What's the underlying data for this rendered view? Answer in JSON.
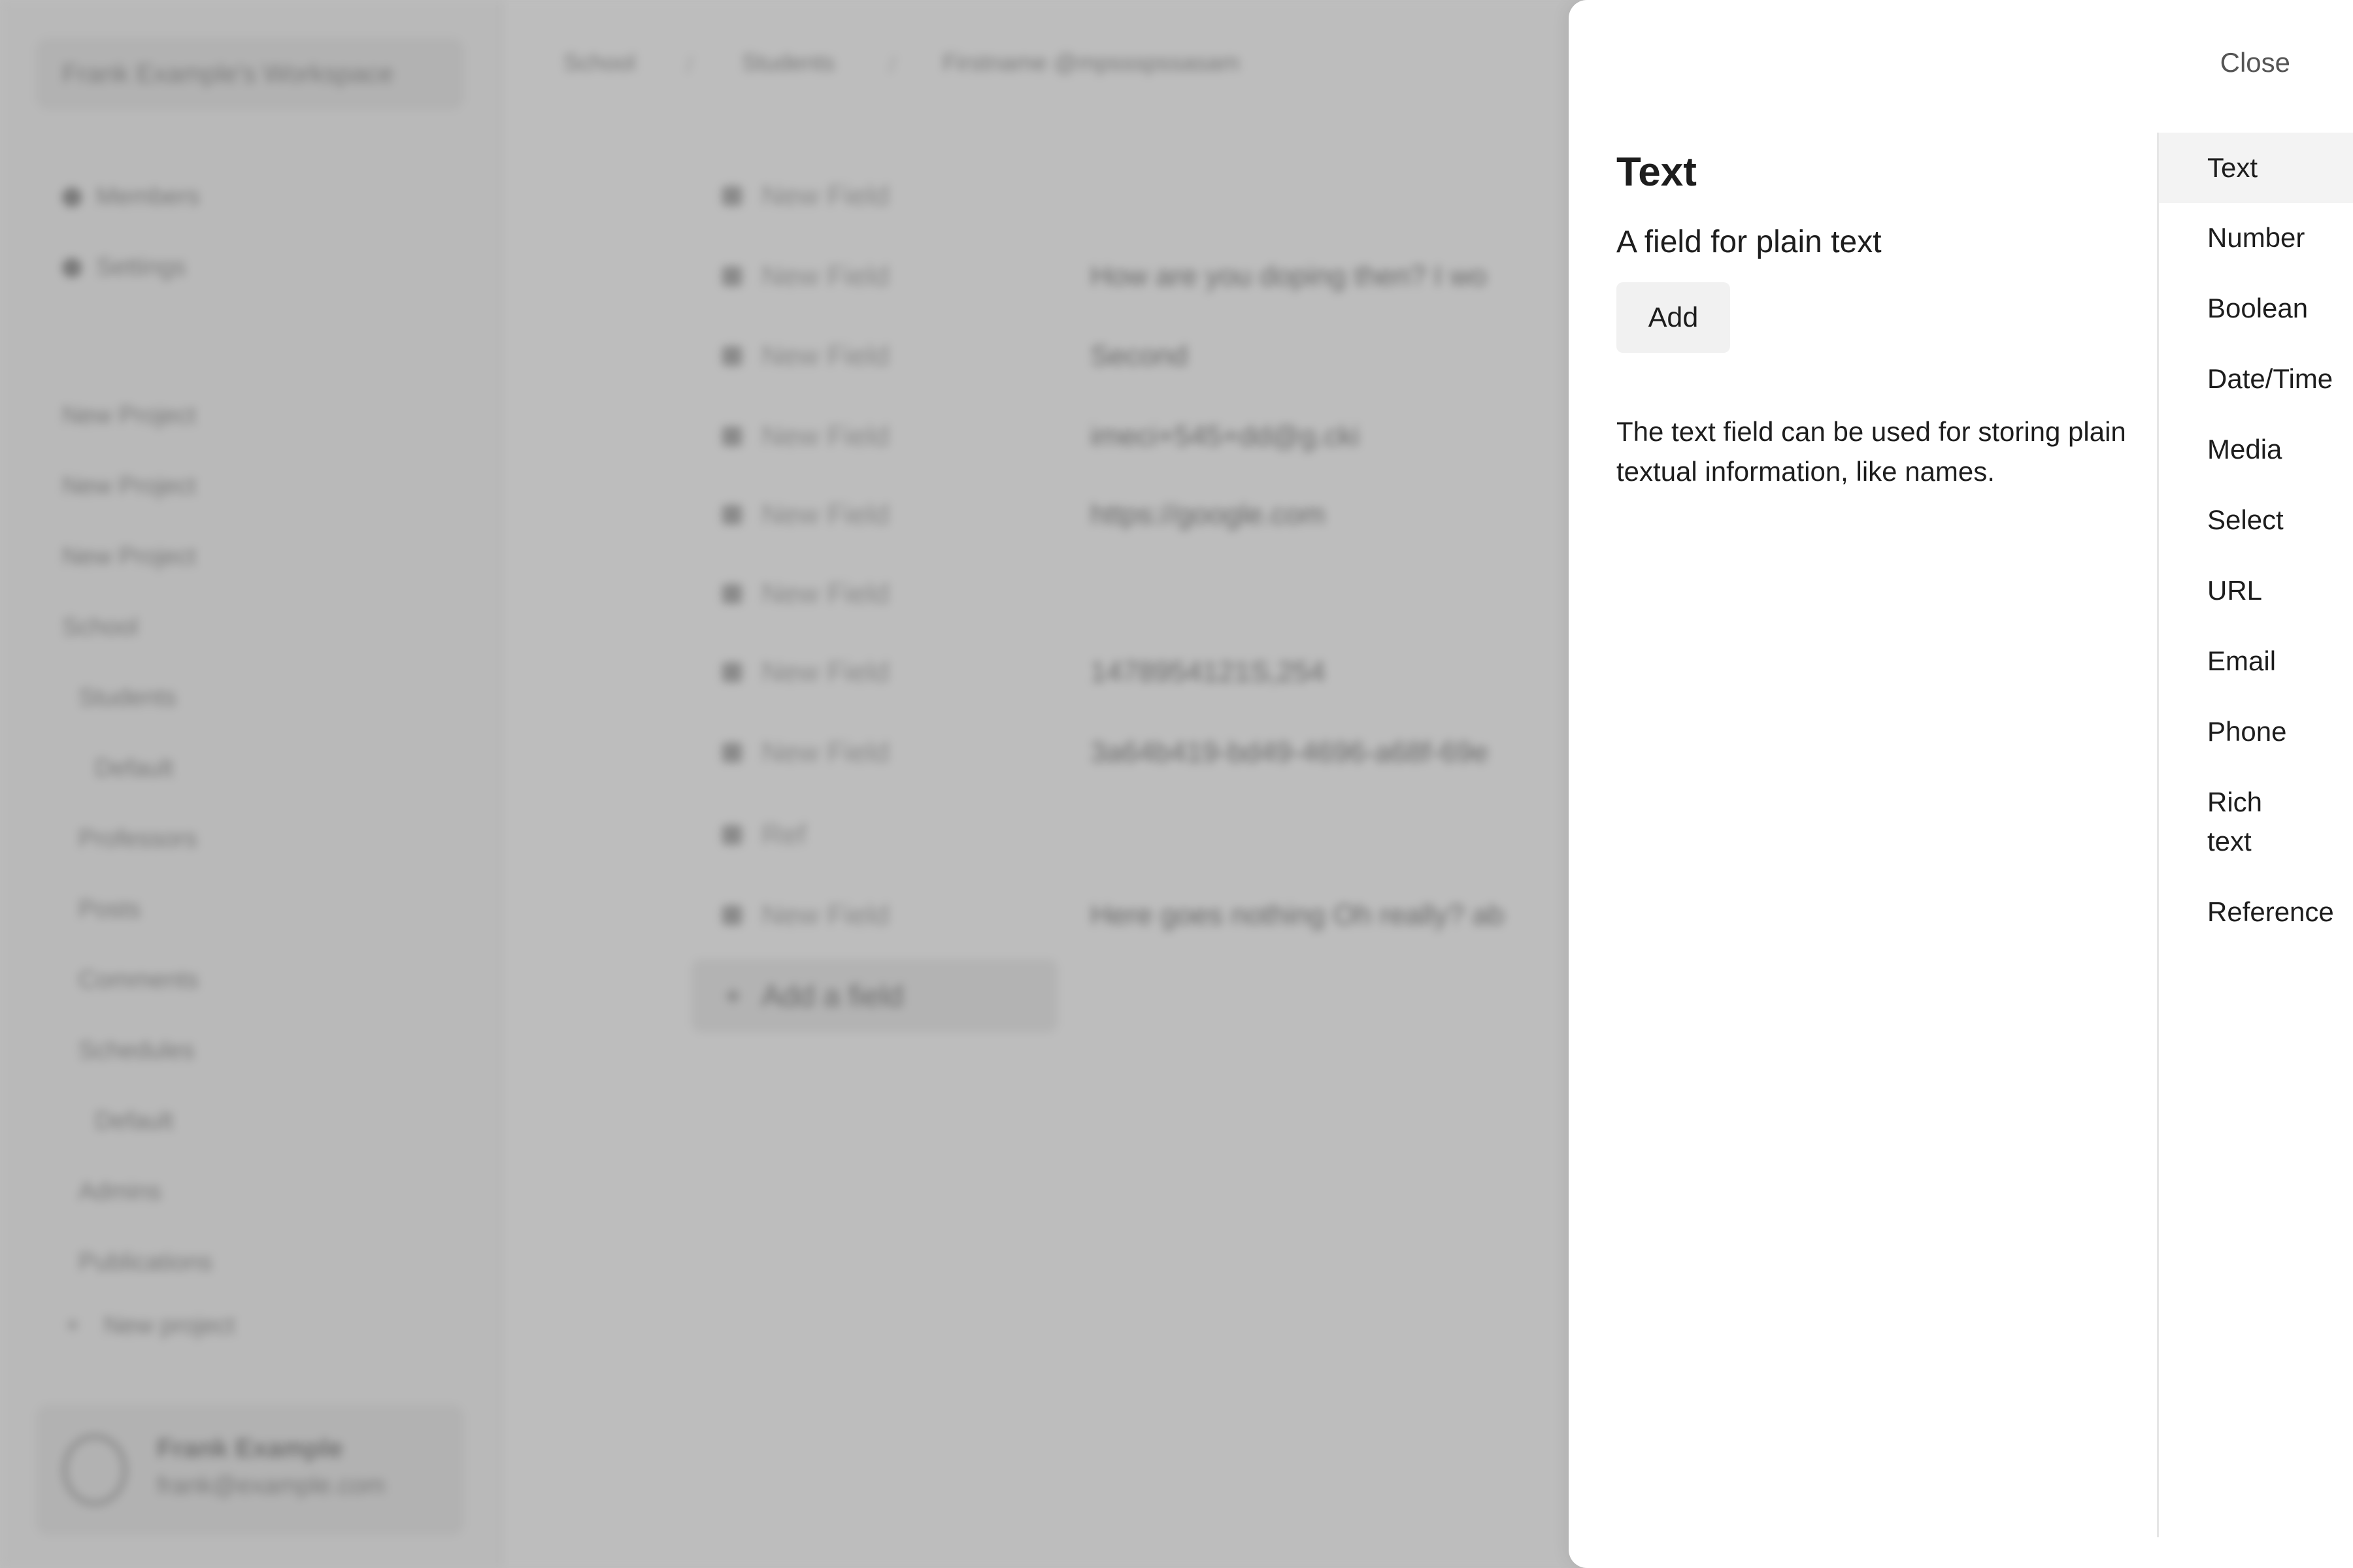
{
  "background": {
    "workspace_switcher": "Frank Example's Workspace",
    "nav": [
      {
        "label": "Members"
      },
      {
        "label": "Settings"
      }
    ],
    "projects": [
      "New Project",
      "New Project",
      "New Project",
      "School",
      "Students",
      "Default",
      "Professors",
      "Posts",
      "Comments",
      "Schedules",
      "Default",
      "Admins",
      "Publications"
    ],
    "new_project": "New project",
    "user": {
      "name": "Frank Example",
      "email": "frank@example.com"
    },
    "breadcrumbs": [
      "School",
      "Students",
      "Firstname @mpssspssasam"
    ],
    "fields": [
      {
        "label": "New Field",
        "value": ""
      },
      {
        "label": "New Field",
        "value": "How are you doping then? I wo"
      },
      {
        "label": "New Field",
        "value": "Second"
      },
      {
        "label": "New Field",
        "value": "imeci+545+dd@g.cki"
      },
      {
        "label": "New Field",
        "value": "https://google.com"
      },
      {
        "label": "New Field",
        "value": ""
      },
      {
        "label": "New Field",
        "value": "1478954121S,254"
      },
      {
        "label": "New Field",
        "value": "3a64b419-bd49-4696-a68f-69e"
      },
      {
        "label": "Ref",
        "value": ""
      },
      {
        "label": "New Field",
        "value": "Here goes nothing Oh really? ab"
      }
    ],
    "add_field": "Add a field"
  },
  "drawer": {
    "close_label": "Close",
    "selected": {
      "title": "Text",
      "subtitle": "A field for plain text",
      "add_label": "Add",
      "description": "The text field can be used for storing plain textual information, like names."
    },
    "types": [
      {
        "label": "Text",
        "selected": true
      },
      {
        "label": "Number",
        "selected": false
      },
      {
        "label": "Boolean",
        "selected": false
      },
      {
        "label": "Date/Time",
        "selected": false
      },
      {
        "label": "Media",
        "selected": false
      },
      {
        "label": "Select",
        "selected": false
      },
      {
        "label": "URL",
        "selected": false
      },
      {
        "label": "Email",
        "selected": false
      },
      {
        "label": "Phone",
        "selected": false
      },
      {
        "label": "Rich text",
        "selected": false
      },
      {
        "label": "Reference",
        "selected": false
      }
    ]
  }
}
